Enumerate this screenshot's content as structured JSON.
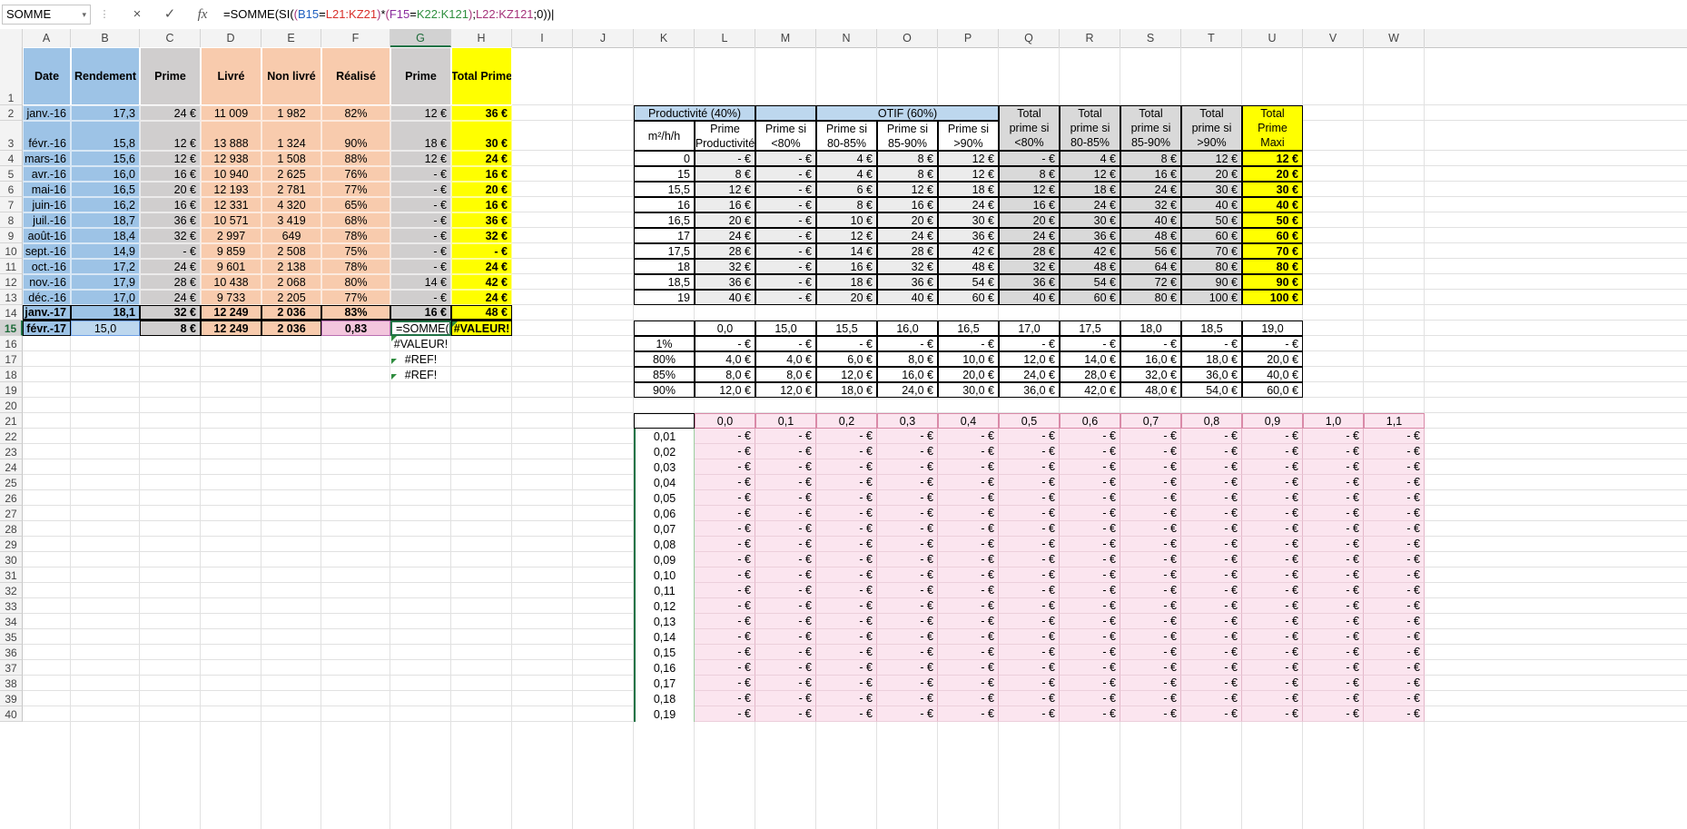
{
  "formula_bar": {
    "name_box": "SOMME",
    "cancel_icon": "×",
    "enter_icon": "✓",
    "fx_label": "fx",
    "formula_parts": [
      {
        "t": "=SOMME(SI(",
        "c": ""
      },
      {
        "t": "(",
        "c": "fr-m"
      },
      {
        "t": "B15",
        "c": "fr-b"
      },
      {
        "t": "=",
        "c": ""
      },
      {
        "t": "L21:KZ21",
        "c": "fr-r"
      },
      {
        "t": ")",
        "c": "fr-m"
      },
      {
        "t": "*",
        "c": ""
      },
      {
        "t": "(",
        "c": "fr-m"
      },
      {
        "t": "F15",
        "c": "fr-p"
      },
      {
        "t": "=",
        "c": ""
      },
      {
        "t": "K22:K121",
        "c": "fr-g"
      },
      {
        "t": ")",
        "c": "fr-m"
      },
      {
        "t": ";",
        "c": ""
      },
      {
        "t": "L22:KZ121",
        "c": "fr-m"
      },
      {
        "t": ";0))",
        "c": ""
      }
    ]
  },
  "columns": [
    "A",
    "B",
    "C",
    "D",
    "E",
    "F",
    "G",
    "H",
    "I",
    "J",
    "K",
    "L",
    "M",
    "N",
    "O",
    "P",
    "Q",
    "R",
    "S",
    "T",
    "U",
    "V",
    "W"
  ],
  "rows": [
    "1",
    "2",
    "3",
    "4",
    "5",
    "6",
    "7",
    "8",
    "9",
    "10",
    "11",
    "12",
    "13",
    "14",
    "15",
    "16",
    "17",
    "18",
    "19",
    "20",
    "21",
    "22",
    "23",
    "24",
    "25",
    "26",
    "27",
    "28",
    "29",
    "30",
    "31",
    "32",
    "33",
    "34",
    "35",
    "36",
    "37",
    "38",
    "39",
    "40"
  ],
  "selected_column": "G",
  "selected_row": "15",
  "left_table": {
    "headers": [
      "Date",
      "Rendement",
      "Prime",
      "Livré",
      "Non livré",
      "Réalisé",
      "Prime",
      "Total Prime"
    ],
    "rows": [
      [
        "janv.-16",
        "17,3",
        "24 €",
        "11 009",
        "1 982",
        "82%",
        "12 €",
        "36 €"
      ],
      [
        "févr.-16",
        "15,8",
        "12 €",
        "13 888",
        "1 324",
        "90%",
        "18 €",
        "30 €"
      ],
      [
        "mars-16",
        "15,6",
        "12 €",
        "12 938",
        "1 508",
        "88%",
        "12 €",
        "24 €"
      ],
      [
        "avr.-16",
        "16,0",
        "16 €",
        "10 940",
        "2 625",
        "76%",
        "-   €",
        "16 €"
      ],
      [
        "mai-16",
        "16,5",
        "20 €",
        "12 193",
        "2 781",
        "77%",
        "-   €",
        "20 €"
      ],
      [
        "juin-16",
        "16,2",
        "16 €",
        "12 331",
        "4 320",
        "65%",
        "-   €",
        "16 €"
      ],
      [
        "juil.-16",
        "18,7",
        "36 €",
        "10 571",
        "3 419",
        "68%",
        "-   €",
        "36 €"
      ],
      [
        "août-16",
        "18,4",
        "32 €",
        "2 997",
        "649",
        "78%",
        "-   €",
        "32 €"
      ],
      [
        "sept.-16",
        "14,9",
        "-   €",
        "9 859",
        "2 508",
        "75%",
        "-   €",
        "-   €"
      ],
      [
        "oct.-16",
        "17,2",
        "24 €",
        "9 601",
        "2 138",
        "78%",
        "-   €",
        "24 €"
      ],
      [
        "nov.-16",
        "17,9",
        "28 €",
        "10 438",
        "2 068",
        "80%",
        "14 €",
        "42 €"
      ],
      [
        "déc.-16",
        "17,0",
        "24 €",
        "9 733",
        "2 205",
        "77%",
        "-   €",
        "24 €"
      ],
      [
        "janv.-17",
        "18,1",
        "32 €",
        "12 249",
        "2 036",
        "83%",
        "16 €",
        "48 €"
      ],
      [
        "févr.-17",
        "15,0",
        "8 €",
        "12 249",
        "2 036",
        "0,83",
        "=SOMME(SI(",
        "#VALEUR!"
      ]
    ],
    "g_extra": [
      "#VALEUR!",
      "#REF!",
      "#REF!"
    ]
  },
  "right_table": {
    "group_headers": [
      "Productivité (40%)",
      "OTIF (60%)"
    ],
    "headers": [
      "m²/h/h",
      "Prime Productivité",
      "Prime si <80%",
      "Prime si  80-85%",
      "Prime si 85-90%",
      "Prime si >90%",
      "Total prime si <80%",
      "Total prime si 80-85%",
      "Total prime si 85-90%",
      "Total prime si >90%",
      "Total Prime Maxi"
    ],
    "rows": [
      [
        "0",
        "-   €",
        "-   €",
        "4 €",
        "8 €",
        "12 €",
        "-   €",
        "4 €",
        "8 €",
        "12 €",
        "12 €"
      ],
      [
        "15",
        "8 €",
        "-   €",
        "4 €",
        "8 €",
        "12 €",
        "8 €",
        "12 €",
        "16 €",
        "20 €",
        "20 €"
      ],
      [
        "15,5",
        "12 €",
        "-   €",
        "6 €",
        "12 €",
        "18 €",
        "12 €",
        "18 €",
        "24 €",
        "30 €",
        "30 €"
      ],
      [
        "16",
        "16 €",
        "-   €",
        "8 €",
        "16 €",
        "24 €",
        "16 €",
        "24 €",
        "32 €",
        "40 €",
        "40 €"
      ],
      [
        "16,5",
        "20 €",
        "-   €",
        "10 €",
        "20 €",
        "30 €",
        "20 €",
        "30 €",
        "40 €",
        "50 €",
        "50 €"
      ],
      [
        "17",
        "24 €",
        "-   €",
        "12 €",
        "24 €",
        "36 €",
        "24 €",
        "36 €",
        "48 €",
        "60 €",
        "60 €"
      ],
      [
        "17,5",
        "28 €",
        "-   €",
        "14 €",
        "28 €",
        "42 €",
        "28 €",
        "42 €",
        "56 €",
        "70 €",
        "70 €"
      ],
      [
        "18",
        "32 €",
        "-   €",
        "16 €",
        "32 €",
        "48 €",
        "32 €",
        "48 €",
        "64 €",
        "80 €",
        "80 €"
      ],
      [
        "18,5",
        "36 €",
        "-   €",
        "18 €",
        "36 €",
        "54 €",
        "36 €",
        "54 €",
        "72 €",
        "90 €",
        "90 €"
      ],
      [
        "19",
        "40 €",
        "-   €",
        "20 €",
        "40 €",
        "60 €",
        "40 €",
        "60 €",
        "80 €",
        "100 €",
        "100 €"
      ]
    ]
  },
  "mid_table": {
    "header": [
      "0,0",
      "15,0",
      "15,5",
      "16,0",
      "16,5",
      "17,0",
      "17,5",
      "18,0",
      "18,5",
      "19,0"
    ],
    "rows": [
      [
        "1%",
        "-   €",
        "-   €",
        "-   €",
        "-   €",
        "-   €",
        "-   €",
        "-   €",
        "-   €",
        "-   €",
        "-   €"
      ],
      [
        "80%",
        "4,0 €",
        "4,0 €",
        "6,0 €",
        "8,0 €",
        "10,0 €",
        "12,0 €",
        "14,0 €",
        "16,0 €",
        "18,0 €",
        "20,0 €"
      ],
      [
        "85%",
        "8,0 €",
        "8,0 €",
        "12,0 €",
        "16,0 €",
        "20,0 €",
        "24,0 €",
        "28,0 €",
        "32,0 €",
        "36,0 €",
        "40,0 €"
      ],
      [
        "90%",
        "12,0 €",
        "12,0 €",
        "18,0 €",
        "24,0 €",
        "30,0 €",
        "36,0 €",
        "42,0 €",
        "48,0 €",
        "54,0 €",
        "60,0 €"
      ]
    ]
  },
  "bottom_table": {
    "header": [
      "0,0",
      "0,1",
      "0,2",
      "0,3",
      "0,4",
      "0,5",
      "0,6",
      "0,7",
      "0,8",
      "0,9",
      "1,0",
      "1,1"
    ],
    "row_labels": [
      "0,01",
      "0,02",
      "0,03",
      "0,04",
      "0,05",
      "0,06",
      "0,07",
      "0,08",
      "0,09",
      "0,10",
      "0,11",
      "0,12",
      "0,13",
      "0,14",
      "0,15",
      "0,16",
      "0,17",
      "0,18",
      "0,19"
    ],
    "cell_value": "-   €"
  },
  "colors": {
    "blue": "#9dc3e6",
    "peach": "#f8cbad",
    "gray": "#d0cece",
    "yellow": "#ffff00",
    "excel_green": "#217346"
  }
}
